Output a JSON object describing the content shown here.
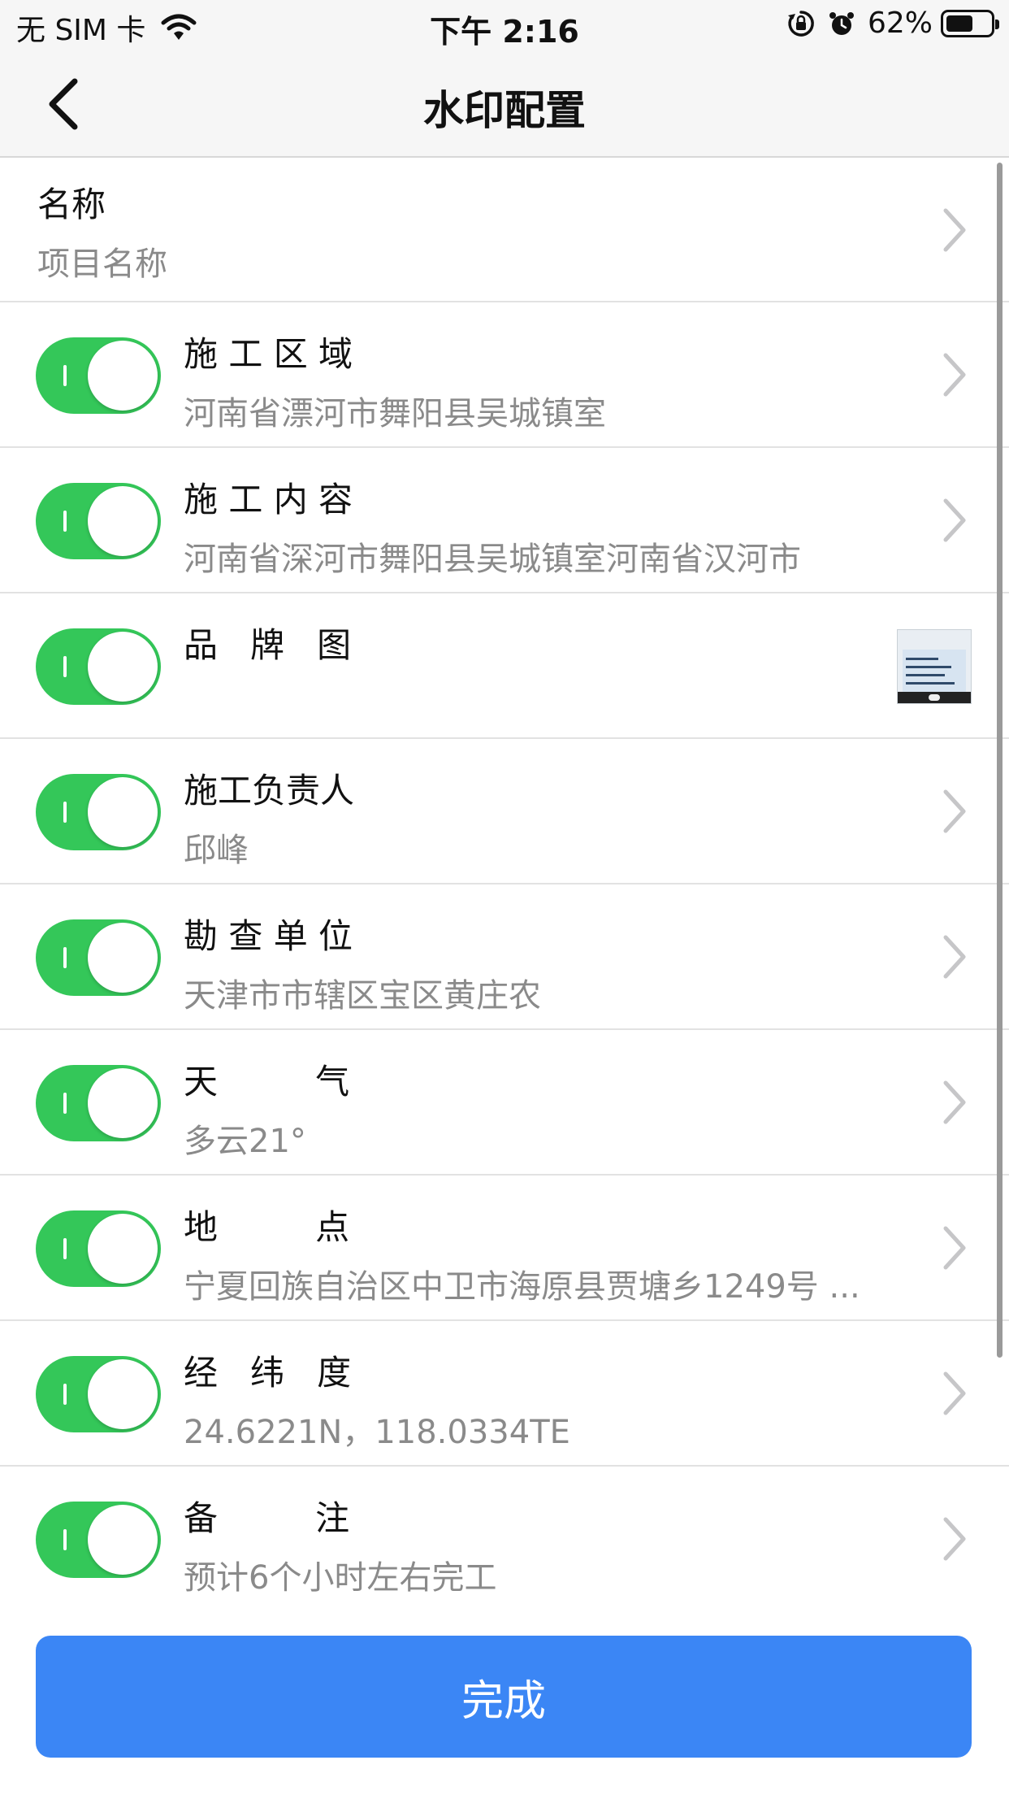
{
  "status_bar": {
    "carrier": "无 SIM 卡",
    "time": "下午 2:16",
    "battery": "62%",
    "battery_level": 0.62
  },
  "nav": {
    "title": "水印配置"
  },
  "rows": [
    {
      "title": "名称",
      "value": "项目名称",
      "has_toggle": false
    },
    {
      "title": "施 工 区 域",
      "value": "河南省漂河市舞阳县吴城镇室",
      "has_toggle": true,
      "on": true
    },
    {
      "title": "施 工 内 容",
      "value": "河南省深河市舞阳县吴城镇室河南省汉河市",
      "has_toggle": true,
      "on": true
    },
    {
      "title": "品   牌   图",
      "value": "",
      "has_toggle": true,
      "on": true,
      "has_thumbnail": true
    },
    {
      "title": "施工负责人",
      "value": "邱峰",
      "has_toggle": true,
      "on": true
    },
    {
      "title": "勘 查 单 位",
      "value": "天津市市辖区宝区黄庄农",
      "has_toggle": true,
      "on": true
    },
    {
      "title": "天         气",
      "value": "多云21°",
      "has_toggle": true,
      "on": true
    },
    {
      "title": "地         点",
      "value": "宁夏回族自治区中卫市海原县贾塘乡1249号 ...",
      "has_toggle": true,
      "on": true
    },
    {
      "title": "经   纬   度",
      "value": "24.6221N，118.0334TE",
      "has_toggle": true,
      "on": true
    },
    {
      "title": "备         注",
      "value": "预计6个小时左右完工",
      "has_toggle": true,
      "on": true
    }
  ],
  "footer": {
    "done_label": "完成"
  },
  "colors": {
    "toggle_on": "#34c759",
    "primary": "#3b86f5"
  }
}
